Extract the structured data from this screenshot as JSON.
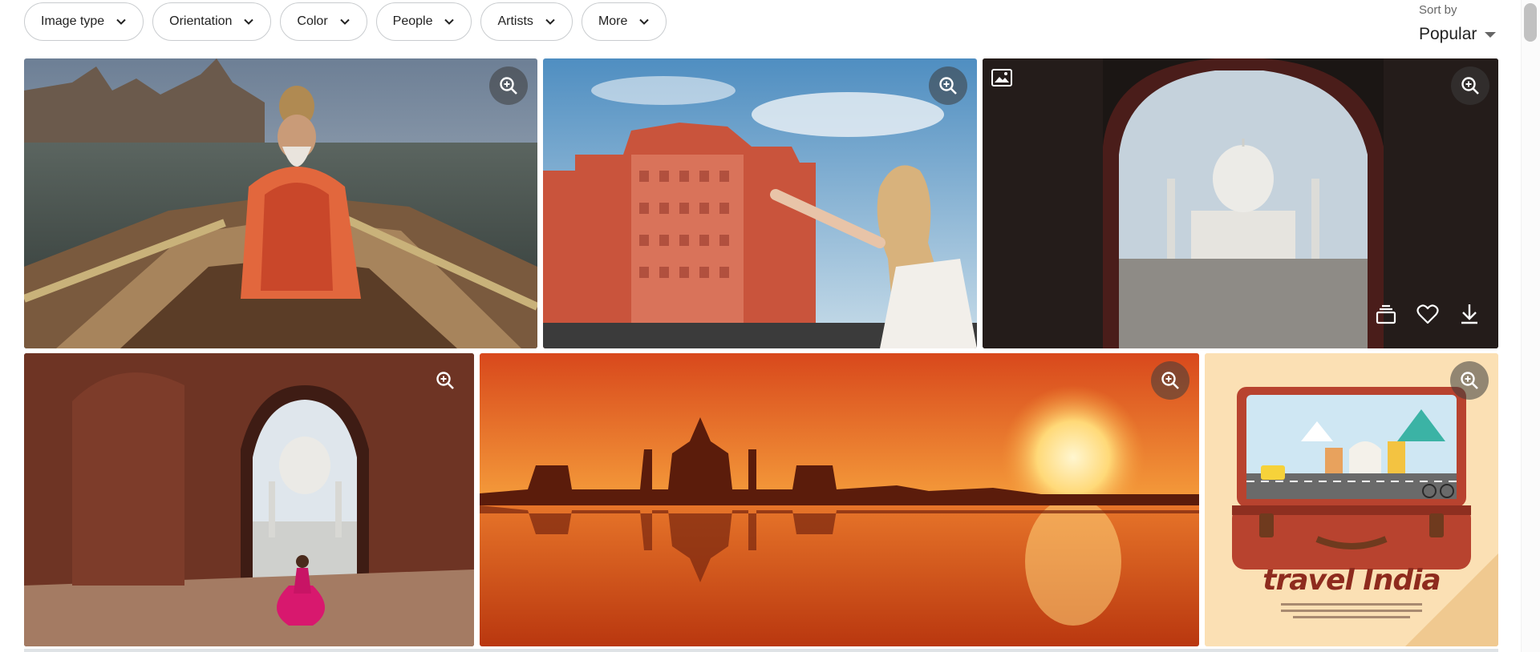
{
  "filters": [
    {
      "label": "Image type"
    },
    {
      "label": "Orientation"
    },
    {
      "label": "Color"
    },
    {
      "label": "People"
    },
    {
      "label": "Artists"
    },
    {
      "label": "More"
    }
  ],
  "sort": {
    "label": "Sort by",
    "value": "Popular"
  },
  "tiles": [
    {
      "subject": "Sadhu rowing a wooden boat on the Ganges at Varanasi"
    },
    {
      "subject": "Woman pointing at Hawa Mahal palace in Jaipur"
    },
    {
      "subject": "Taj Mahal seen through a dark arched gateway"
    },
    {
      "subject": "Woman in pink sari under arch facing the Taj Mahal"
    },
    {
      "subject": "Taj Mahal silhouette reflected at orange sunset"
    },
    {
      "subject": "Illustration of open suitcase with Indian landmarks",
      "caption": "travel India"
    }
  ],
  "colors": {
    "chip_border": "#c9cccf",
    "zoom_bg": "#3c3c3c",
    "sunset": "#e2531a",
    "poster_bg": "#fbe0b4",
    "suitcase": "#b8432f"
  },
  "icons": {
    "zoom": "zoom-in-icon",
    "chevron": "chevron-down-icon",
    "image_type": "image-type-icon",
    "board": "add-to-board-icon",
    "like": "heart-icon",
    "download": "download-icon"
  }
}
